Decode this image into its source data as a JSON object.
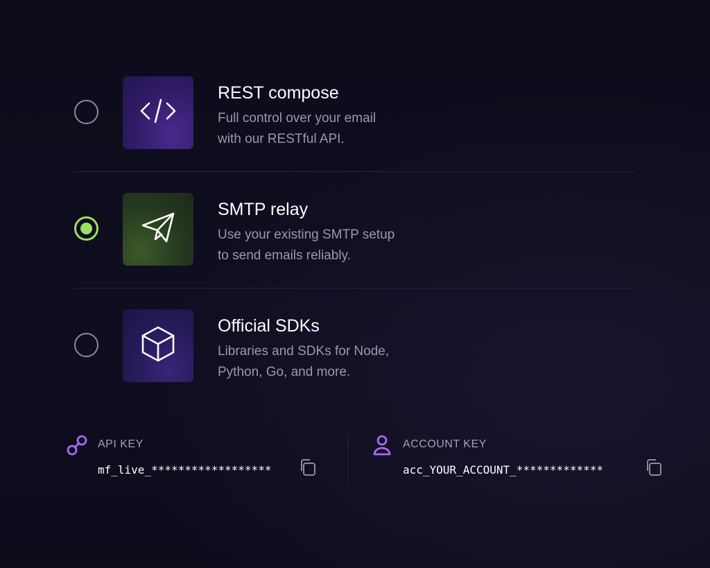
{
  "options": [
    {
      "title": "REST compose",
      "desc_line1": "Full control over your email",
      "desc_line2": "with our RESTful API.",
      "icon": "code-icon",
      "selected": false
    },
    {
      "title": "SMTP relay",
      "desc_line1": "Use your existing SMTP setup",
      "desc_line2": "to send emails reliably.",
      "icon": "paper-plane-icon",
      "selected": true
    },
    {
      "title": "Official SDKs",
      "desc_line1": "Libraries and SDKs for Node,",
      "desc_line2": "Python, Go, and more.",
      "icon": "cube-icon",
      "selected": false
    }
  ],
  "keys": {
    "api": {
      "label": "API KEY",
      "value": "mf_live_******************",
      "icon": "link-icon"
    },
    "account": {
      "label": "ACCOUNT KEY",
      "value": "acc_YOUR_ACCOUNT_*************",
      "icon": "user-icon"
    }
  },
  "colors": {
    "accent_green": "#9be15d",
    "accent_purple": "#a968f0",
    "radio_unselected": "#8d8b9e",
    "background": "#0e0d1e"
  }
}
